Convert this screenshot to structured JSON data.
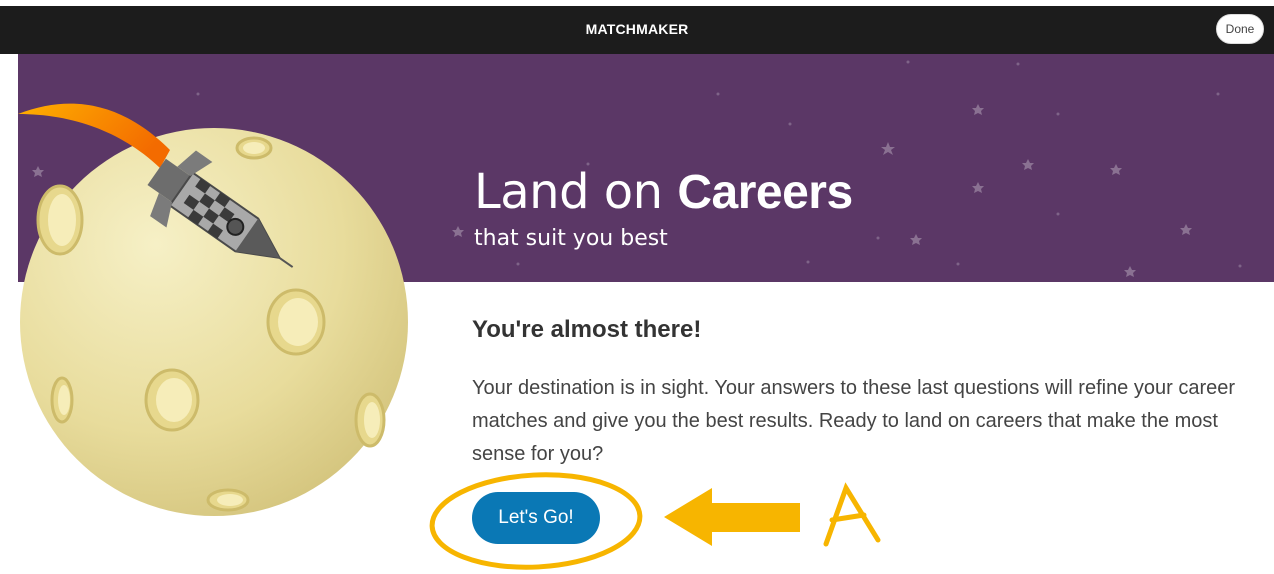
{
  "app": {
    "title": "MATCHMAKER",
    "done_label": "Done"
  },
  "banner": {
    "headline_light": "Land on ",
    "headline_bold": "Careers",
    "subhead": "that suit you best"
  },
  "content": {
    "heading": "You're almost there!",
    "body": "Your destination is in sight. Your answers to these last questions will refine your career matches and give you the best results. Ready to land on careers that make the most sense for you?",
    "cta_label": "Let's Go!"
  },
  "annotation": {
    "letter": "A",
    "color": "#f7b500"
  },
  "colors": {
    "topbar": "#1c1c1c",
    "banner": "#5b3766",
    "cta": "#0a78b5",
    "moon": "#eadf9f"
  },
  "icons": [
    "rocket-icon",
    "moon-illustration",
    "star-icon",
    "arrow-annotation"
  ]
}
